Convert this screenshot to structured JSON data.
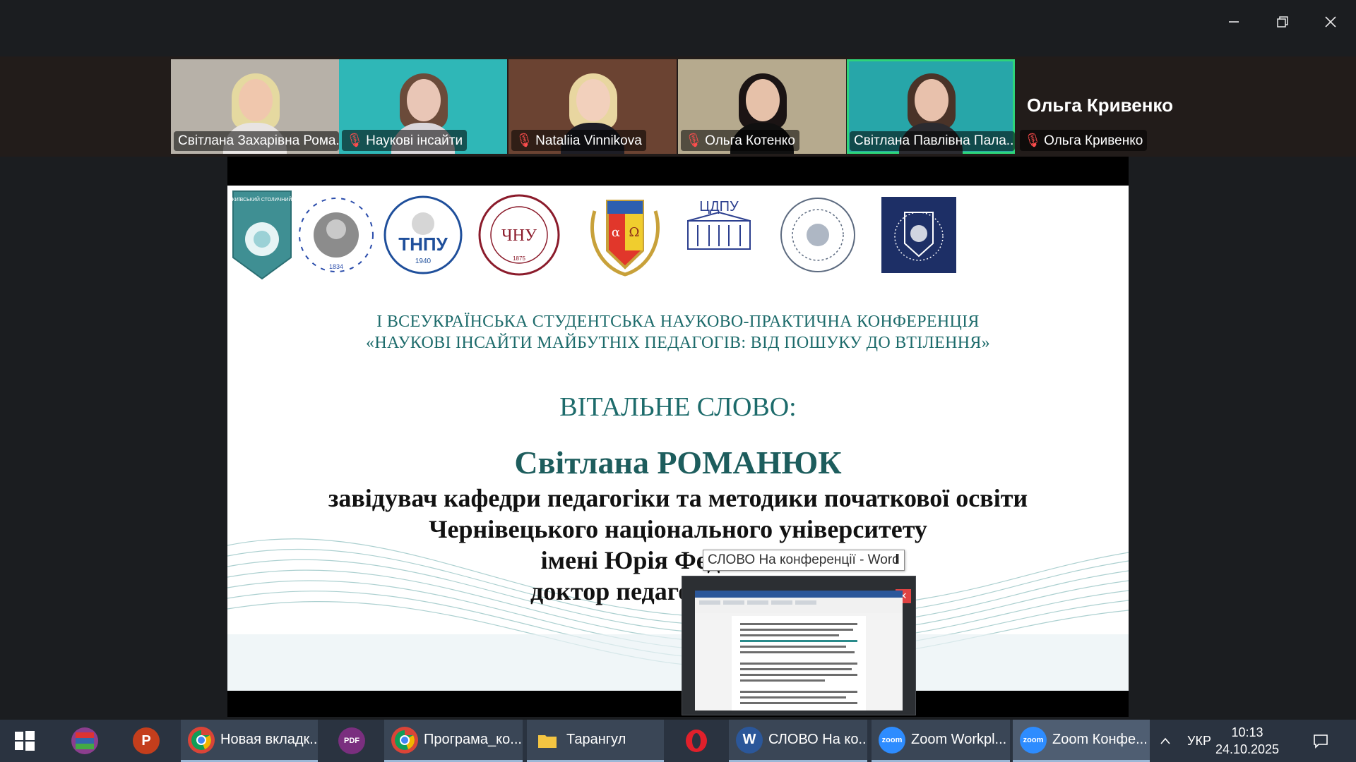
{
  "window": {
    "minimize_icon": "minimize-icon",
    "maximize_icon": "restore-icon",
    "close_icon": "close-icon"
  },
  "participants": [
    {
      "name": "Світлана Захарівна Рома...",
      "muted": false,
      "bg": "#b7b1a8",
      "hair": "#e5d9a0",
      "skin": "#f0c7ad",
      "clothes": "#e8e4e2"
    },
    {
      "name": "Наукові інсайти",
      "muted": true,
      "bg": "#2fb7b7",
      "hair": "#6b4b3a",
      "skin": "#e9c6b6",
      "clothes": "#d9d6da"
    },
    {
      "name": "Nataliia Vinnikova",
      "muted": true,
      "bg": "#6b4332",
      "hair": "#e8d6a0",
      "skin": "#f2d0bc",
      "clothes": "#1d1d25"
    },
    {
      "name": "Ольга Котенко",
      "muted": true,
      "bg": "#b6aa8e",
      "hair": "#1b1414",
      "skin": "#e6c1a9",
      "clothes": "#101010"
    },
    {
      "name": "Світлана Павлівна Пала...",
      "muted": false,
      "bg": "#27a6a9",
      "hair": "#4a3328",
      "skin": "#e8c1ac",
      "clothes": "#2b2b30"
    }
  ],
  "active_speaker": {
    "display_name": "Ольга Кривенко",
    "label": "Ольга Кривенко",
    "muted": true
  },
  "slide": {
    "logos": [
      "Київський столичний університет імені Бориса Грінченка",
      "Дрогобицький державний педагогічний університет імені Івана Франка 1834",
      "ТНПУ 1940",
      "ЧНУ 1875",
      "alpha-omega-emblem",
      "ЦДПУ",
      "university-seal",
      "university-coat-of-arms"
    ],
    "title_line1": "І ВСЕУКРАЇНСЬКА СТУДЕНТСЬКА НАУКОВО-ПРАКТИЧНА КОНФЕРЕНЦІЯ",
    "title_line2": "«НАУКОВІ ІНСАЙТИ МАЙБУТНІХ ПЕДАГОГІВ: ВІД ПОШУКУ ДО ВТІЛЕННЯ»",
    "greeting": "ВІТАЛЬНЕ СЛОВО:",
    "speaker": "Світлана РОМАНЮК",
    "role_line1": "завідувач кафедри педагогіки та методики початкової освіти",
    "role_line2": "Чернівецького національного університету",
    "role_line3": "імені Юрія Федьковича",
    "role_line4": "доктор педагогічних наук"
  },
  "tooltip": "СЛОВО На конференції - Word",
  "taskbar": {
    "items": [
      {
        "label": "",
        "icon": "windows-start-icon"
      },
      {
        "label": "",
        "icon": "winrar-icon"
      },
      {
        "label": "",
        "icon": "powerpoint-icon"
      },
      {
        "label": "Новая вкладк...",
        "icon": "chrome-icon"
      },
      {
        "label": "",
        "icon": "pdf-icon"
      },
      {
        "label": "Програма_ко...",
        "icon": "chrome-icon"
      },
      {
        "label": "Тарангул",
        "icon": "folder-icon"
      },
      {
        "label": "",
        "icon": "opera-icon"
      },
      {
        "label": "СЛОВО На ко...",
        "icon": "word-icon"
      },
      {
        "label": "Zoom Workpl...",
        "icon": "zoom-icon"
      },
      {
        "label": "Zoom Конфе...",
        "icon": "zoom-icon"
      }
    ],
    "language": "УКР",
    "time": "10:13",
    "date": "24.10.2025"
  }
}
